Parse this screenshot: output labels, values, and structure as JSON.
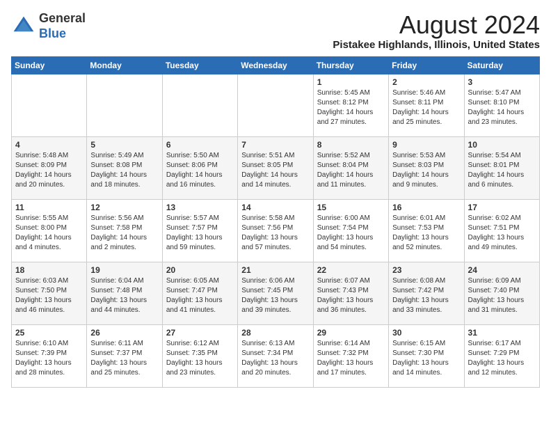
{
  "header": {
    "logo": {
      "line1": "General",
      "line2": "Blue"
    },
    "title": "August 2024",
    "subtitle": "Pistakee Highlands, Illinois, United States"
  },
  "weekdays": [
    "Sunday",
    "Monday",
    "Tuesday",
    "Wednesday",
    "Thursday",
    "Friday",
    "Saturday"
  ],
  "weeks": [
    [
      {
        "day": "",
        "content": ""
      },
      {
        "day": "",
        "content": ""
      },
      {
        "day": "",
        "content": ""
      },
      {
        "day": "",
        "content": ""
      },
      {
        "day": "1",
        "content": "Sunrise: 5:45 AM\nSunset: 8:12 PM\nDaylight: 14 hours\nand 27 minutes."
      },
      {
        "day": "2",
        "content": "Sunrise: 5:46 AM\nSunset: 8:11 PM\nDaylight: 14 hours\nand 25 minutes."
      },
      {
        "day": "3",
        "content": "Sunrise: 5:47 AM\nSunset: 8:10 PM\nDaylight: 14 hours\nand 23 minutes."
      }
    ],
    [
      {
        "day": "4",
        "content": "Sunrise: 5:48 AM\nSunset: 8:09 PM\nDaylight: 14 hours\nand 20 minutes."
      },
      {
        "day": "5",
        "content": "Sunrise: 5:49 AM\nSunset: 8:08 PM\nDaylight: 14 hours\nand 18 minutes."
      },
      {
        "day": "6",
        "content": "Sunrise: 5:50 AM\nSunset: 8:06 PM\nDaylight: 14 hours\nand 16 minutes."
      },
      {
        "day": "7",
        "content": "Sunrise: 5:51 AM\nSunset: 8:05 PM\nDaylight: 14 hours\nand 14 minutes."
      },
      {
        "day": "8",
        "content": "Sunrise: 5:52 AM\nSunset: 8:04 PM\nDaylight: 14 hours\nand 11 minutes."
      },
      {
        "day": "9",
        "content": "Sunrise: 5:53 AM\nSunset: 8:03 PM\nDaylight: 14 hours\nand 9 minutes."
      },
      {
        "day": "10",
        "content": "Sunrise: 5:54 AM\nSunset: 8:01 PM\nDaylight: 14 hours\nand 6 minutes."
      }
    ],
    [
      {
        "day": "11",
        "content": "Sunrise: 5:55 AM\nSunset: 8:00 PM\nDaylight: 14 hours\nand 4 minutes."
      },
      {
        "day": "12",
        "content": "Sunrise: 5:56 AM\nSunset: 7:58 PM\nDaylight: 14 hours\nand 2 minutes."
      },
      {
        "day": "13",
        "content": "Sunrise: 5:57 AM\nSunset: 7:57 PM\nDaylight: 13 hours\nand 59 minutes."
      },
      {
        "day": "14",
        "content": "Sunrise: 5:58 AM\nSunset: 7:56 PM\nDaylight: 13 hours\nand 57 minutes."
      },
      {
        "day": "15",
        "content": "Sunrise: 6:00 AM\nSunset: 7:54 PM\nDaylight: 13 hours\nand 54 minutes."
      },
      {
        "day": "16",
        "content": "Sunrise: 6:01 AM\nSunset: 7:53 PM\nDaylight: 13 hours\nand 52 minutes."
      },
      {
        "day": "17",
        "content": "Sunrise: 6:02 AM\nSunset: 7:51 PM\nDaylight: 13 hours\nand 49 minutes."
      }
    ],
    [
      {
        "day": "18",
        "content": "Sunrise: 6:03 AM\nSunset: 7:50 PM\nDaylight: 13 hours\nand 46 minutes."
      },
      {
        "day": "19",
        "content": "Sunrise: 6:04 AM\nSunset: 7:48 PM\nDaylight: 13 hours\nand 44 minutes."
      },
      {
        "day": "20",
        "content": "Sunrise: 6:05 AM\nSunset: 7:47 PM\nDaylight: 13 hours\nand 41 minutes."
      },
      {
        "day": "21",
        "content": "Sunrise: 6:06 AM\nSunset: 7:45 PM\nDaylight: 13 hours\nand 39 minutes."
      },
      {
        "day": "22",
        "content": "Sunrise: 6:07 AM\nSunset: 7:43 PM\nDaylight: 13 hours\nand 36 minutes."
      },
      {
        "day": "23",
        "content": "Sunrise: 6:08 AM\nSunset: 7:42 PM\nDaylight: 13 hours\nand 33 minutes."
      },
      {
        "day": "24",
        "content": "Sunrise: 6:09 AM\nSunset: 7:40 PM\nDaylight: 13 hours\nand 31 minutes."
      }
    ],
    [
      {
        "day": "25",
        "content": "Sunrise: 6:10 AM\nSunset: 7:39 PM\nDaylight: 13 hours\nand 28 minutes."
      },
      {
        "day": "26",
        "content": "Sunrise: 6:11 AM\nSunset: 7:37 PM\nDaylight: 13 hours\nand 25 minutes."
      },
      {
        "day": "27",
        "content": "Sunrise: 6:12 AM\nSunset: 7:35 PM\nDaylight: 13 hours\nand 23 minutes."
      },
      {
        "day": "28",
        "content": "Sunrise: 6:13 AM\nSunset: 7:34 PM\nDaylight: 13 hours\nand 20 minutes."
      },
      {
        "day": "29",
        "content": "Sunrise: 6:14 AM\nSunset: 7:32 PM\nDaylight: 13 hours\nand 17 minutes."
      },
      {
        "day": "30",
        "content": "Sunrise: 6:15 AM\nSunset: 7:30 PM\nDaylight: 13 hours\nand 14 minutes."
      },
      {
        "day": "31",
        "content": "Sunrise: 6:17 AM\nSunset: 7:29 PM\nDaylight: 13 hours\nand 12 minutes."
      }
    ]
  ]
}
